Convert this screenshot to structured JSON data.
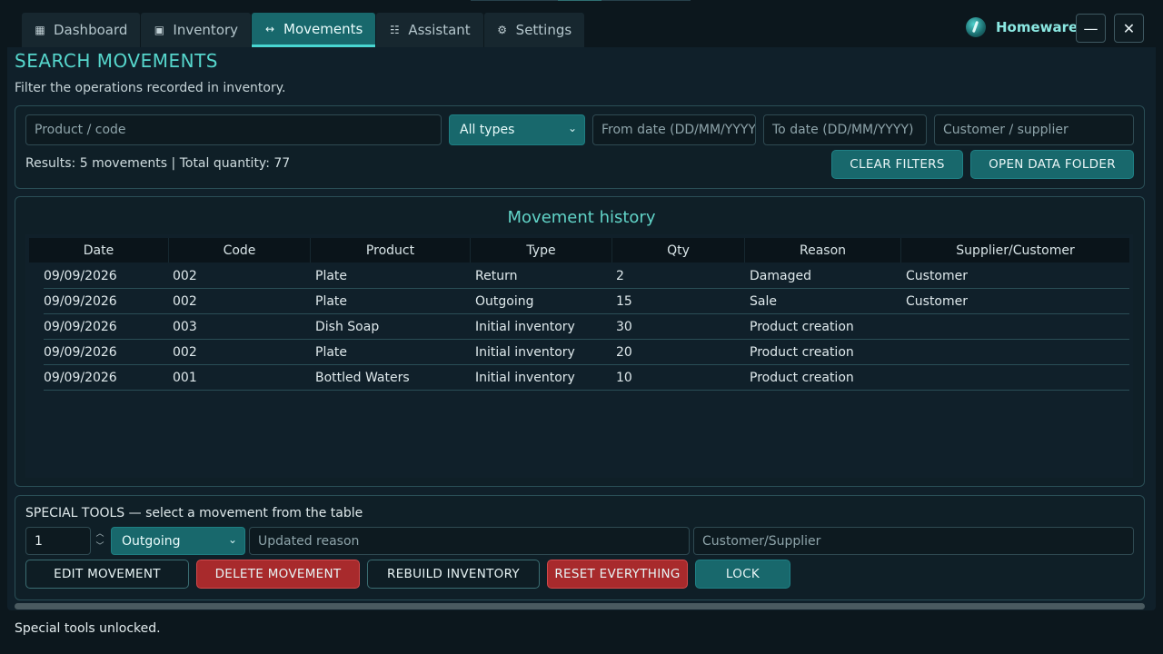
{
  "tabs": [
    {
      "label": "Dashboard",
      "icon": "grid-icon"
    },
    {
      "label": "Inventory",
      "icon": "box-icon"
    },
    {
      "label": "Movements",
      "icon": "arrows-icon"
    },
    {
      "label": "Assistant",
      "icon": "list-icon"
    },
    {
      "label": "Settings",
      "icon": "gear-icon"
    }
  ],
  "active_tab": "Movements",
  "brand": {
    "name": "Homeware",
    "icon": "logo-icon"
  },
  "window": {
    "minimize": "—",
    "close": "✕"
  },
  "page": {
    "title": "SEARCH MOVEMENTS",
    "subtitle": "Filter the operations recorded in inventory."
  },
  "filters": {
    "product_placeholder": "Product / code",
    "type_selected": "All types",
    "from_placeholder": "From date (DD/MM/YYYY)",
    "to_placeholder": "To date (DD/MM/YYYY)",
    "party_placeholder": "Customer / supplier",
    "results": "Results: 5 movements | Total quantity: 77",
    "clear_label": "CLEAR FILTERS",
    "open_folder_label": "OPEN DATA FOLDER"
  },
  "history": {
    "title": "Movement history",
    "columns": [
      "Date",
      "Code",
      "Product",
      "Type",
      "Qty",
      "Reason",
      "Supplier/Customer"
    ],
    "rows": [
      [
        "09/09/2026",
        "002",
        "Plate",
        "Return",
        "2",
        "Damaged",
        "Customer"
      ],
      [
        "09/09/2026",
        "002",
        "Plate",
        "Outgoing",
        "15",
        "Sale",
        "Customer"
      ],
      [
        "09/09/2026",
        "003",
        "Dish Soap",
        "Initial inventory",
        "30",
        "Product creation",
        ""
      ],
      [
        "09/09/2026",
        "002",
        "Plate",
        "Initial inventory",
        "20",
        "Product creation",
        ""
      ],
      [
        "09/09/2026",
        "001",
        "Bottled Waters",
        "Initial inventory",
        "10",
        "Product creation",
        ""
      ]
    ]
  },
  "tools": {
    "title": "SPECIAL TOOLS — select a movement from the table",
    "quantity_value": "1",
    "type_selected": "Outgoing",
    "reason_placeholder": "Updated reason",
    "party_placeholder": "Customer/Supplier",
    "edit_label": "EDIT MOVEMENT",
    "delete_label": "DELETE MOVEMENT",
    "rebuild_label": "REBUILD INVENTORY",
    "reset_label": "RESET EVERYTHING",
    "lock_label": "LOCK"
  },
  "status": "Special tools unlocked.",
  "colors": {
    "accent": "#18686c",
    "accent_text": "#56d6cc",
    "danger": "#a82a2c"
  }
}
